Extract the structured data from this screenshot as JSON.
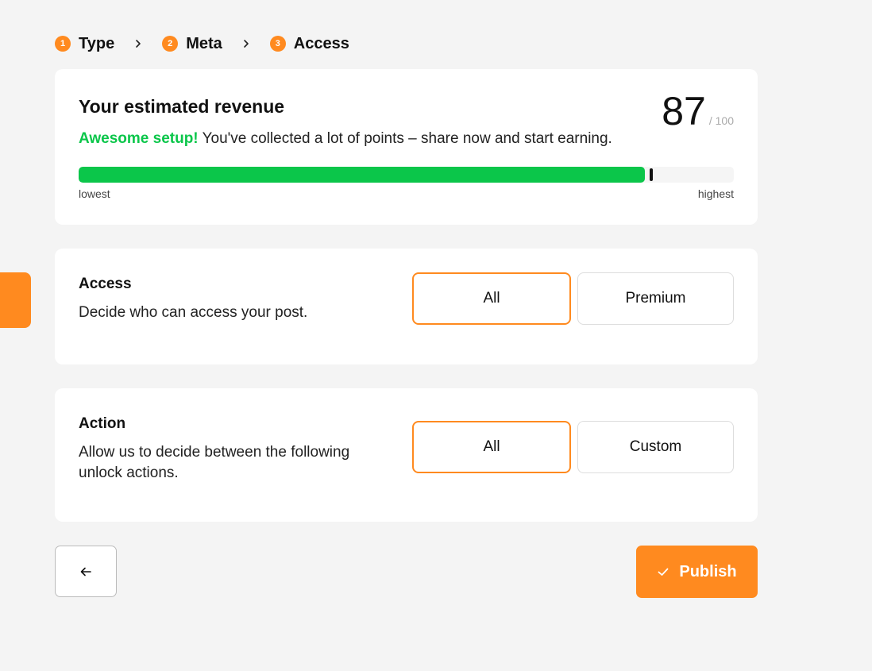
{
  "stepper": {
    "steps": [
      {
        "num": "1",
        "label": "Type"
      },
      {
        "num": "2",
        "label": "Meta"
      },
      {
        "num": "3",
        "label": "Access"
      }
    ]
  },
  "revenue": {
    "title": "Your estimated revenue",
    "highlight": "Awesome setup!",
    "description": " You've collected a lot of points – share now and start earning.",
    "score": "87",
    "score_max": "/ 100",
    "progress_fraction": 0.87,
    "scale_low": "lowest",
    "scale_high": "highest",
    "color_progress": "#0bc64a"
  },
  "access": {
    "title": "Access",
    "description": "Decide who can access your post.",
    "options": [
      {
        "label": "All",
        "selected": true
      },
      {
        "label": "Premium",
        "selected": false
      }
    ]
  },
  "action": {
    "title": "Action",
    "description": "Allow us to decide between the following unlock actions.",
    "options": [
      {
        "label": "All",
        "selected": true
      },
      {
        "label": "Custom",
        "selected": false
      }
    ]
  },
  "footer": {
    "back_icon": "arrow-left-icon",
    "publish_icon": "check-icon",
    "publish_label": "Publish"
  },
  "colors": {
    "accent": "#ff8a1f",
    "success": "#0bc64a",
    "background": "#f4f4f4"
  }
}
